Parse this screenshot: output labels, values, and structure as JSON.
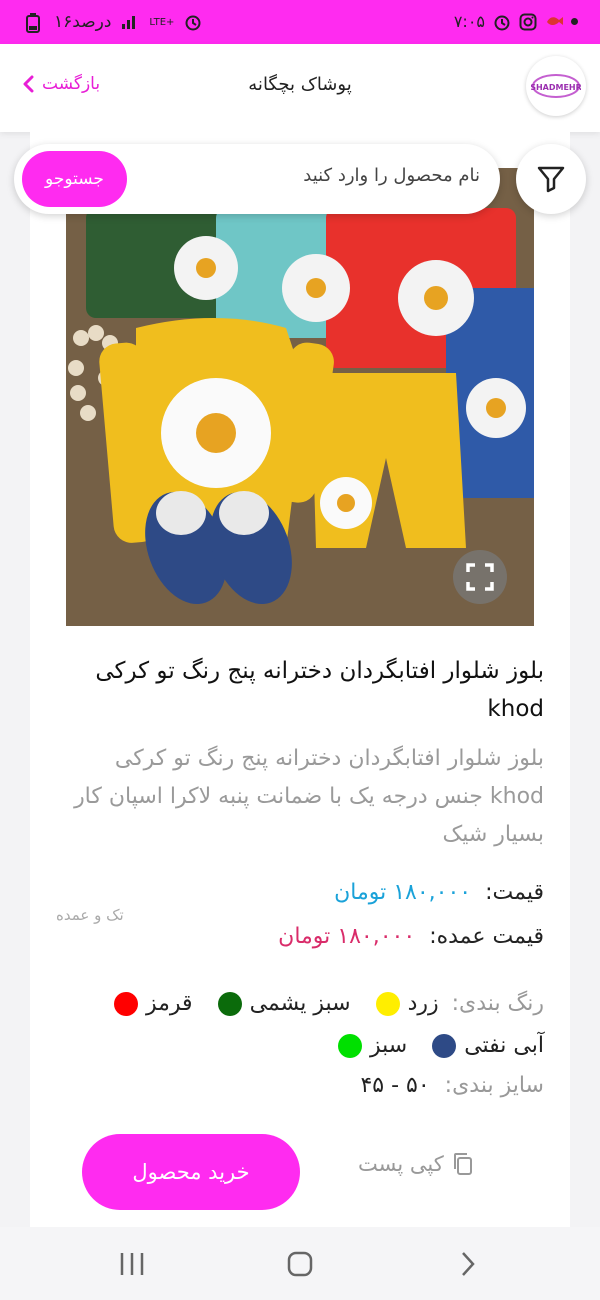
{
  "status_bar": {
    "time": "۷:۰۵",
    "battery": "۱۶درصد",
    "network": "LTE+",
    "icons": [
      "alarm-icon",
      "instagram-icon",
      "app-icon",
      "dot-icon",
      "signal-icon",
      "battery-icon"
    ]
  },
  "header": {
    "title": "پوشاک بچگانه",
    "back_label": "بازگشت",
    "logo_text": "SHADMEHR"
  },
  "search": {
    "placeholder": "نام محصول را وارد کنید",
    "button_label": "جستوجو"
  },
  "product": {
    "title": "بلوز شلوار افتابگردان دخترانه پنج رنگ تو کرکی khod",
    "description": "بلوز شلوار افتابگردان دخترانه پنج رنگ تو کرکی khod جنس درجه یک با ضمانت پنبه لاکرا اسپان کار بسیار شیک",
    "price_label": "قیمت:",
    "price_value": "۱۸۰,۰۰۰ تومان",
    "wholesale_label": "قیمت عمده:",
    "wholesale_value": "۱۸۰,۰۰۰ تومان",
    "sale_type": "تک و عمده",
    "colors_label": "رنگ بندی:",
    "colors": [
      {
        "name": "زرد",
        "hex": "#ffee00"
      },
      {
        "name": "سبز یشمی",
        "hex": "#0b6b0b"
      },
      {
        "name": "قرمز",
        "hex": "#ff0000"
      },
      {
        "name": "آبی نفتی",
        "hex": "#2e4a86"
      },
      {
        "name": "سبز",
        "hex": "#00e000"
      }
    ],
    "sizes_label": "سایز بندی:",
    "sizes_value": "۵۰ - ۴۵",
    "buy_label": "خرید محصول",
    "copy_label": "کپی پست"
  },
  "colors": {
    "accent": "#ff2bf0",
    "price": "#1aa2d9",
    "wholesale": "#d92c6a"
  }
}
